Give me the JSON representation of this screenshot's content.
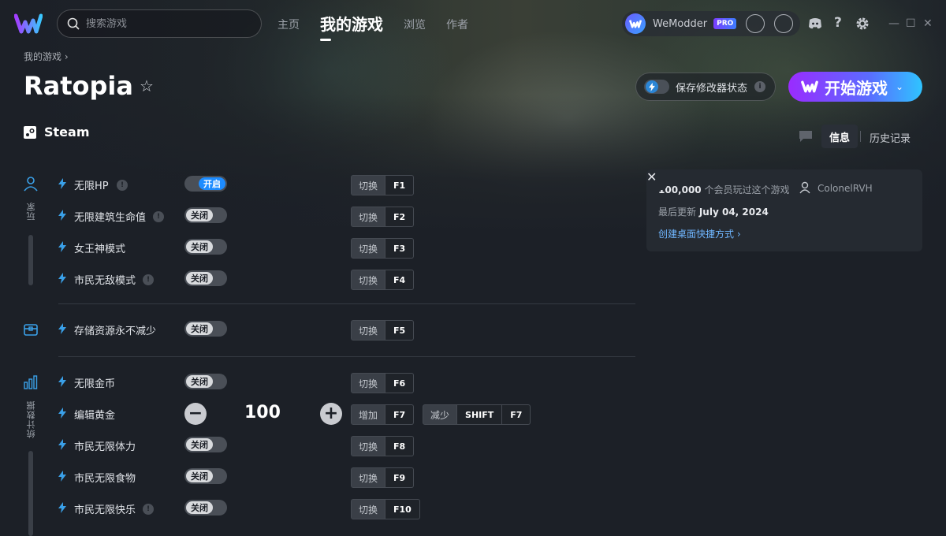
{
  "app": {
    "search_placeholder": "搜索游戏",
    "nav": [
      "主页",
      "我的游戏",
      "浏览",
      "作者"
    ],
    "nav_active_index": 1,
    "username": "WeModder",
    "pro_badge": "PRO"
  },
  "game": {
    "breadcrumb": "我的游戏 ›",
    "title": "Ratopia",
    "platform": "Steam",
    "save_state_label": "保存修改器状态",
    "save_state_info": "i",
    "play_label": "开始游戏"
  },
  "tabs": {
    "info": "信息",
    "history": "历史记录"
  },
  "categories": [
    {
      "name": "玩家",
      "icon": "person-icon"
    },
    {
      "name": "",
      "icon": "chest-icon"
    },
    {
      "name": "统计数据",
      "icon": "stats-icon"
    }
  ],
  "cheats": [
    {
      "name": "无限HP",
      "warn": true,
      "state": "开启",
      "on": true,
      "action": "切换",
      "key": "F1"
    },
    {
      "name": "无限建筑生命值",
      "warn": true,
      "state": "关闭",
      "on": false,
      "action": "切换",
      "key": "F2"
    },
    {
      "name": "女王神模式",
      "warn": false,
      "state": "关闭",
      "on": false,
      "action": "切换",
      "key": "F3"
    },
    {
      "name": "市民无敌模式",
      "warn": true,
      "state": "关闭",
      "on": false,
      "action": "切换",
      "key": "F4"
    },
    {
      "name": "存储资源永不减少",
      "warn": false,
      "state": "关闭",
      "on": false,
      "action": "切换",
      "key": "F5"
    },
    {
      "name": "无限金币",
      "warn": false,
      "state": "关闭",
      "on": false,
      "action": "切换",
      "key": "F6"
    },
    {
      "name": "编辑黄金",
      "value": "100",
      "inc_action": "增加",
      "inc_key": "F7",
      "dec_action": "减少",
      "dec_mod": "SHIFT",
      "dec_key": "F7"
    },
    {
      "name": "市民无限体力",
      "warn": false,
      "state": "关闭",
      "on": false,
      "action": "切换",
      "key": "F8"
    },
    {
      "name": "市民无限食物",
      "warn": false,
      "state": "关闭",
      "on": false,
      "action": "切换",
      "key": "F9"
    },
    {
      "name": "市民无限快乐",
      "warn": true,
      "state": "关闭",
      "on": false,
      "action": "切换",
      "key": "F10"
    }
  ],
  "info_panel": {
    "players_count": "100,000",
    "players_text": "个会员玩过这个游戏",
    "author": "ColonelRVH",
    "updated_label": "最后更新",
    "updated_date": "July 04, 2024",
    "shortcut_link": "创建桌面快捷方式 ›",
    "close": "✕"
  },
  "colors": {
    "accent_blue": "#1d8cff",
    "play_gradient_start": "#9a2bff",
    "play_gradient_end": "#2fc4ff",
    "link": "#6fb6ff"
  }
}
